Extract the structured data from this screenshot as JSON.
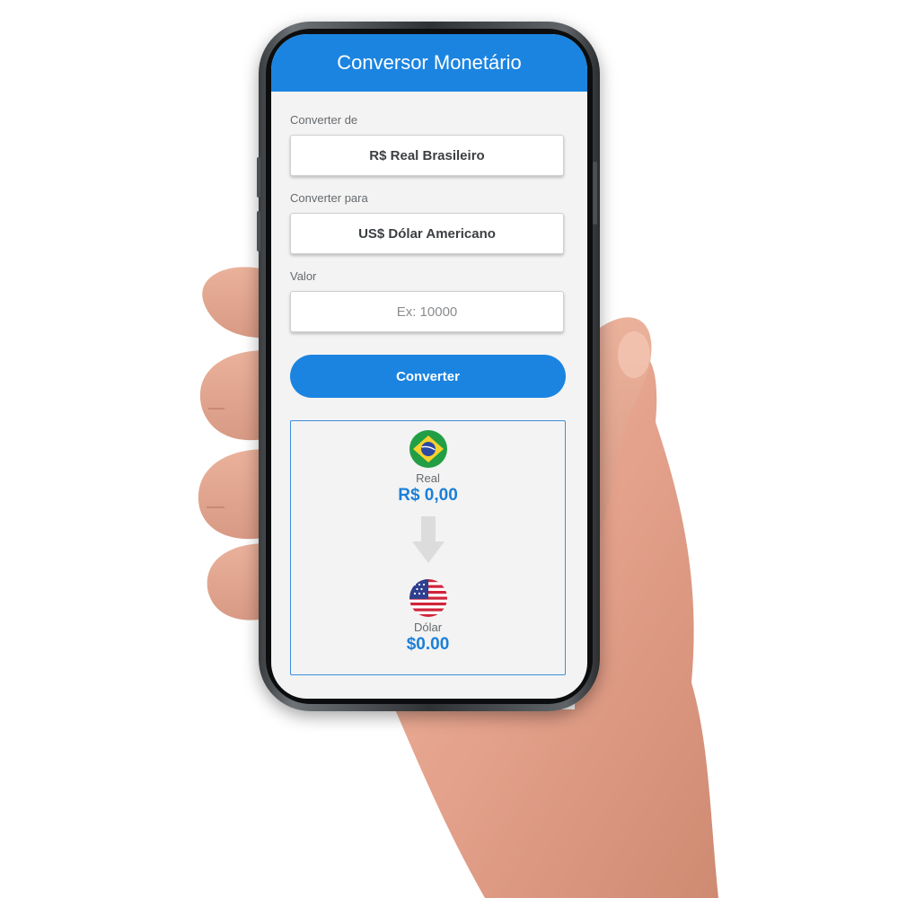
{
  "app": {
    "title": "Conversor Monetário"
  },
  "form": {
    "from_label": "Converter de",
    "from_value": "R$ Real Brasileiro",
    "to_label": "Converter para",
    "to_value": "US$ Dólar Americano",
    "amount_label": "Valor",
    "amount_placeholder": "Ex: 10000",
    "convert_button": "Converter"
  },
  "result": {
    "from_currency_name": "Real",
    "from_amount": "R$ 0,00",
    "from_flag_icon": "brazil-flag-icon",
    "arrow_icon": "arrow-down-icon",
    "to_currency_name": "Dólar",
    "to_amount": "$0.00",
    "to_flag_icon": "usa-flag-icon"
  },
  "colors": {
    "primary": "#1b84e0",
    "screen_background": "#f3f3f3",
    "result_border": "#3a8fdb",
    "value_text": "#1b7fd8"
  }
}
